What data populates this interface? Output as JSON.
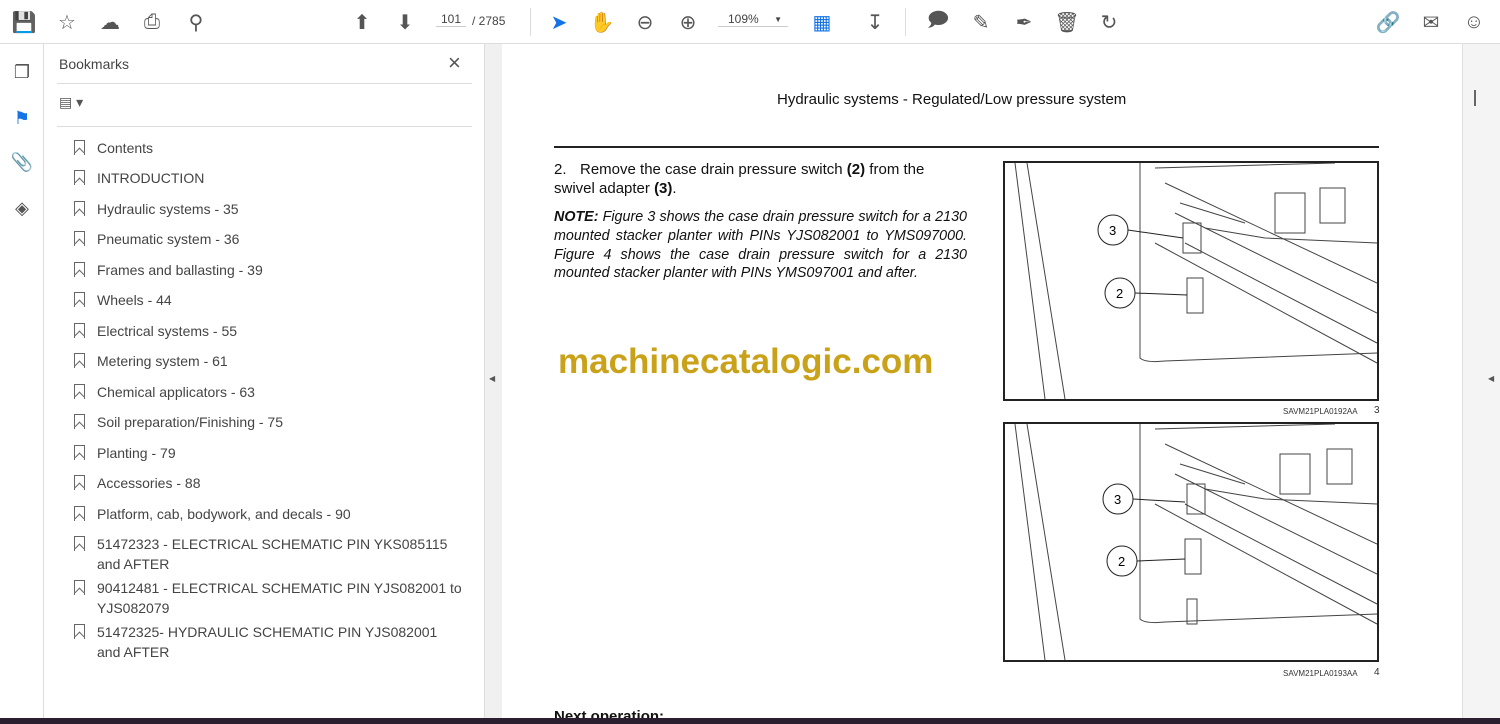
{
  "toolbar": {
    "page_current": "101",
    "page_total": "/ 2785",
    "zoom": "109%"
  },
  "panel": {
    "title": "Bookmarks",
    "items": [
      "Contents",
      "INTRODUCTION",
      "Hydraulic systems - 35",
      "Pneumatic system - 36",
      "Frames and ballasting - 39",
      "Wheels - 44",
      "Electrical systems - 55",
      "Metering system - 61",
      "Chemical applicators - 63",
      "Soil preparation/Finishing - 75",
      "Planting - 79",
      "Accessories - 88",
      "Platform, cab, bodywork, and decals - 90",
      "51472323 - ELECTRICAL SCHEMATIC PIN YKS085115 and AFTER",
      "90412481 - ELECTRICAL SCHEMATIC PIN YJS082001 to YJS082079",
      "51472325- HYDRAULIC SCHEMATIC PIN YJS082001 and AFTER"
    ]
  },
  "document": {
    "header": "Hydraulic systems - Regulated/Low pressure system",
    "step_number": "2.",
    "step_text_1": "Remove the case drain pressure switch ",
    "step_ref_1": "(2)",
    "step_text_2": " from the swivel adapter ",
    "step_ref_2": "(3)",
    "step_text_3": ".",
    "note_label": "NOTE:",
    "note_text": " Figure 3 shows the case drain pressure switch for a 2130 mounted stacker planter with PINs YJS082001 to YMS097000. Figure 4 shows the case drain pressure switch for a 2130 mounted stacker planter with PINs YMS097001 and after.",
    "watermark": "machinecatalogic.com",
    "figures": [
      {
        "caption": "SAVM21PLA0192AA",
        "number": "3",
        "callouts": [
          "3",
          "2"
        ]
      },
      {
        "caption": "SAVM21PLA0193AA",
        "number": "4",
        "callouts": [
          "3",
          "2"
        ]
      }
    ],
    "next": "Next operation:"
  },
  "colors": {
    "accent": "#1473e6",
    "watermark": "#c9a21a"
  }
}
